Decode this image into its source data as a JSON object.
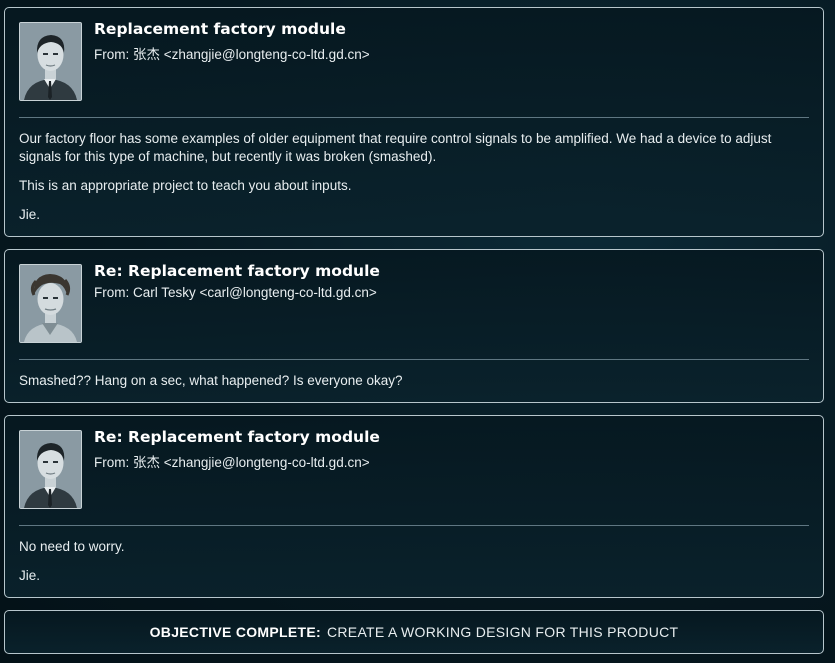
{
  "emails": [
    {
      "subject": "Replacement factory module",
      "from": "From: 张杰 <zhangjie@longteng-co-ltd.gd.cn>",
      "avatar_icon": "portrait-zhang-jie",
      "paragraphs": [
        "Our factory floor has some examples of older equipment that require control signals to be amplified. We had a device to adjust signals for this type of machine, but recently it was broken (smashed).",
        "This is an appropriate project to teach you about inputs.",
        "Jie."
      ]
    },
    {
      "subject": "Re: Replacement factory module",
      "from": "From: Carl Tesky <carl@longteng-co-ltd.gd.cn>",
      "avatar_icon": "portrait-carl-tesky",
      "paragraphs": [
        "Smashed?? Hang on a sec, what happened? Is everyone okay?"
      ]
    },
    {
      "subject": "Re: Replacement factory module",
      "from": "From: 张杰 <zhangjie@longteng-co-ltd.gd.cn>",
      "avatar_icon": "portrait-zhang-jie",
      "paragraphs": [
        "No need to worry.",
        "Jie."
      ]
    }
  ],
  "objective": {
    "label": "OBJECTIVE COMPLETE:",
    "text": "CREATE A WORKING DESIGN FOR THIS PRODUCT"
  }
}
